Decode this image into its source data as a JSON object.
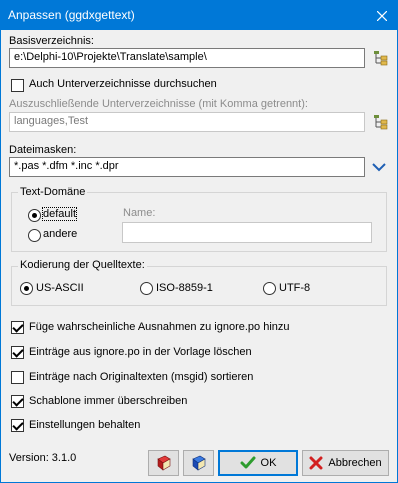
{
  "window": {
    "title": "Anpassen (ggdxgettext)"
  },
  "base_dir": {
    "label": "Basisverzeichnis:",
    "value": "e:\\Delphi-10\\Projekte\\Translate\\sample\\"
  },
  "subdirs": {
    "label": "Auch Unterverzeichnisse durchsuchen",
    "checked": false
  },
  "excluded": {
    "label": "Auszuschließende Unterverzeichnisse (mit Komma getrennt):",
    "value": "languages,Test"
  },
  "masks": {
    "label": "Dateimasken:",
    "value": "*.pas *.dfm *.inc *.dpr"
  },
  "text_domain": {
    "caption": "Text-Domäne",
    "default_label": "default",
    "other_label": "andere",
    "name_label": "Name:",
    "name_value": ""
  },
  "encoding": {
    "caption": "Kodierung der Quelltexte:",
    "options": [
      "US-ASCII",
      "ISO-8859-1",
      "UTF-8"
    ],
    "selected": "US-ASCII"
  },
  "options": [
    {
      "label": "Füge wahrscheinliche Ausnahmen zu ignore.po hinzu",
      "checked": true
    },
    {
      "label": "Einträge aus ignore.po in der Vorlage löschen",
      "checked": true
    },
    {
      "label": "Einträge nach Originaltexten (msgid) sortieren",
      "checked": false
    },
    {
      "label": "Schablone immer überschreiben",
      "checked": true
    },
    {
      "label": "Einstellungen behalten",
      "checked": true
    }
  ],
  "version": "Version: 3.1.0",
  "buttons": {
    "ok": "OK",
    "cancel": "Abbrechen"
  },
  "colors": {
    "titlebar": "#0078d7",
    "ok_check": "#2e9c2e",
    "cancel_x": "#d22020",
    "chevron": "#1e5fb4"
  }
}
